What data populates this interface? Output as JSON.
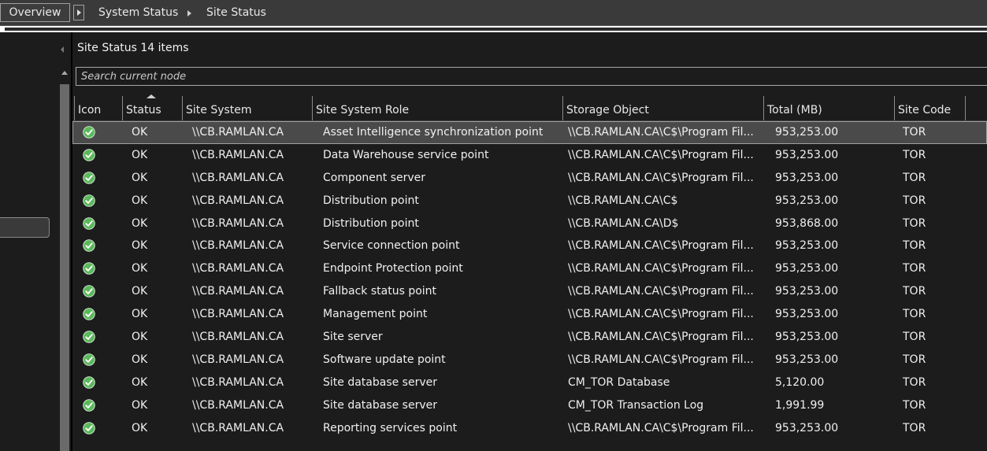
{
  "breadcrumb": {
    "overview": "Overview",
    "items": [
      "System Status",
      "Site Status"
    ]
  },
  "panel": {
    "title": "Site Status 14 items",
    "search_placeholder": "Search current node"
  },
  "columns": [
    "Icon",
    "Status",
    "Site System",
    "Site System Role",
    "Storage Object",
    "Total (MB)",
    "Site Code"
  ],
  "sorted_column": "Status",
  "icon_name": "ok-checkmark-icon",
  "colors": {
    "ok_green": "#5cb85c",
    "background": "#1c1c1c",
    "selected_row": "#4a4a4a"
  },
  "rows": [
    {
      "status": "OK",
      "system": "\\\\CB.RAMLAN.CA",
      "role": "Asset Intelligence synchronization point",
      "storage": "\\\\CB.RAMLAN.CA\\C$\\Program Fil...",
      "total": "953,253.00",
      "code": "TOR",
      "selected": true
    },
    {
      "status": "OK",
      "system": "\\\\CB.RAMLAN.CA",
      "role": "Data Warehouse service point",
      "storage": "\\\\CB.RAMLAN.CA\\C$\\Program Fil...",
      "total": "953,253.00",
      "code": "TOR"
    },
    {
      "status": "OK",
      "system": "\\\\CB.RAMLAN.CA",
      "role": "Component server",
      "storage": "\\\\CB.RAMLAN.CA\\C$\\Program Fil...",
      "total": "953,253.00",
      "code": "TOR"
    },
    {
      "status": "OK",
      "system": "\\\\CB.RAMLAN.CA",
      "role": "Distribution point",
      "storage": "\\\\CB.RAMLAN.CA\\C$",
      "total": "953,253.00",
      "code": "TOR"
    },
    {
      "status": "OK",
      "system": "\\\\CB.RAMLAN.CA",
      "role": "Distribution point",
      "storage": "\\\\CB.RAMLAN.CA\\D$",
      "total": "953,868.00",
      "code": "TOR"
    },
    {
      "status": "OK",
      "system": "\\\\CB.RAMLAN.CA",
      "role": "Service connection point",
      "storage": "\\\\CB.RAMLAN.CA\\C$\\Program Fil...",
      "total": "953,253.00",
      "code": "TOR"
    },
    {
      "status": "OK",
      "system": "\\\\CB.RAMLAN.CA",
      "role": "Endpoint Protection point",
      "storage": "\\\\CB.RAMLAN.CA\\C$\\Program Fil...",
      "total": "953,253.00",
      "code": "TOR"
    },
    {
      "status": "OK",
      "system": "\\\\CB.RAMLAN.CA",
      "role": "Fallback status point",
      "storage": "\\\\CB.RAMLAN.CA\\C$\\Program Fil...",
      "total": "953,253.00",
      "code": "TOR"
    },
    {
      "status": "OK",
      "system": "\\\\CB.RAMLAN.CA",
      "role": "Management point",
      "storage": "\\\\CB.RAMLAN.CA\\C$\\Program Fil...",
      "total": "953,253.00",
      "code": "TOR"
    },
    {
      "status": "OK",
      "system": "\\\\CB.RAMLAN.CA",
      "role": "Site server",
      "storage": "\\\\CB.RAMLAN.CA\\C$\\Program Fil...",
      "total": "953,253.00",
      "code": "TOR"
    },
    {
      "status": "OK",
      "system": "\\\\CB.RAMLAN.CA",
      "role": "Software update point",
      "storage": "\\\\CB.RAMLAN.CA\\C$\\Program Fil...",
      "total": "953,253.00",
      "code": "TOR"
    },
    {
      "status": "OK",
      "system": "\\\\CB.RAMLAN.CA",
      "role": "Site database server",
      "storage": "CM_TOR Database",
      "total": "5,120.00",
      "code": "TOR"
    },
    {
      "status": "OK",
      "system": "\\\\CB.RAMLAN.CA",
      "role": "Site database server",
      "storage": "CM_TOR Transaction Log",
      "total": "1,991.99",
      "code": "TOR"
    },
    {
      "status": "OK",
      "system": "\\\\CB.RAMLAN.CA",
      "role": "Reporting services point",
      "storage": "\\\\CB.RAMLAN.CA\\C$\\Program Fil...",
      "total": "953,253.00",
      "code": "TOR"
    }
  ]
}
